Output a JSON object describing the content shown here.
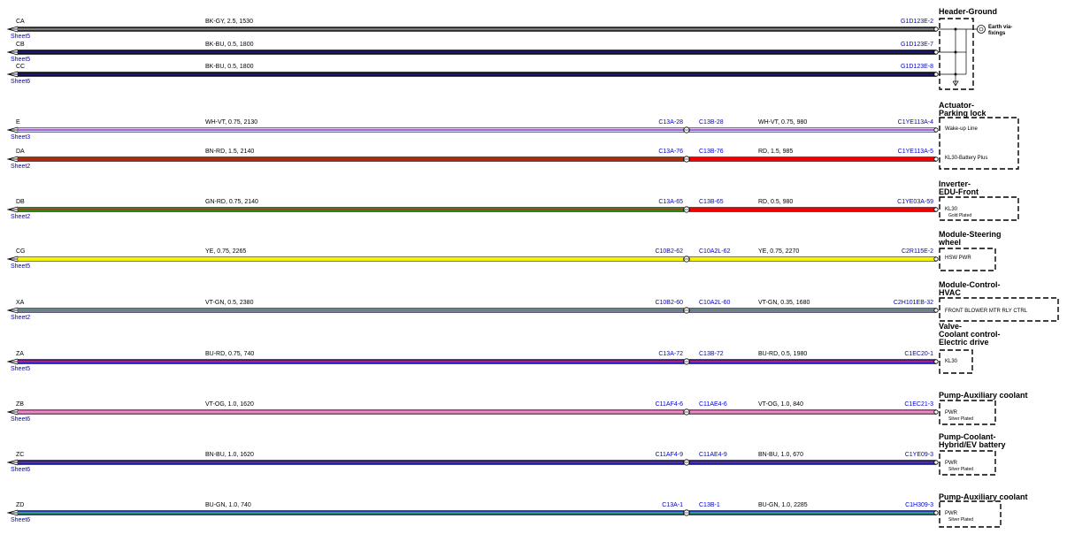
{
  "header_ground": {
    "title": "Header-Ground",
    "earth_label": "Earth via-\nfixings"
  },
  "wires": [
    {
      "id": "CA",
      "sheet": "Sheet5",
      "left_spec": "BK-GY,  2.5,  1530",
      "left_color": "#2a2a2a",
      "left_stripe": "#9a9a9a",
      "terminal": "G1D123E-2",
      "group": "ground"
    },
    {
      "id": "CB",
      "sheet": "Sheet5",
      "left_spec": "BK-BU,  0.5,  1800",
      "left_color": "#111111",
      "left_stripe": "#1a1aa0",
      "terminal": "G1D123E-7",
      "group": "ground"
    },
    {
      "id": "CC",
      "sheet": "Sheet6",
      "left_spec": "BK-BU,  0.5,  1800",
      "left_color": "#111111",
      "left_stripe": "#1a1aa0",
      "terminal": "G1D123E-8",
      "group": "ground"
    },
    {
      "id": "E",
      "sheet": "Sheet3",
      "left_spec": "WH-VT,  0.75,  2130",
      "left_color": "#d0d0ff",
      "left_stripe": "#a040c0",
      "conn_left": "C13A-28",
      "conn_right": "C13B-28",
      "right_spec": "WH-VT,  0.75,  980",
      "right_color": "#d0d0ff",
      "right_stripe": "#a040c0",
      "terminal": "C1YE113A-4"
    },
    {
      "id": "DA",
      "sheet": "Sheet2",
      "left_spec": "BN-RD,  1.5,  2140",
      "left_color": "#8b3a0e",
      "left_stripe": "#cc1a1a",
      "conn_left": "C13A-76",
      "conn_right": "C13B-76",
      "right_spec": "RD,  1.5,  985",
      "right_color": "#ee0000",
      "right_stripe": "#ee0000",
      "terminal": "C1YE113A-5"
    },
    {
      "id": "DB",
      "sheet": "Sheet2",
      "left_spec": "GN-RD,  0.75,  2140",
      "left_color": "#2a8a1a",
      "left_stripe": "#b03a0e",
      "conn_left": "C13A-65",
      "conn_right": "C13B-65",
      "right_spec": "RD,  0.5,  980",
      "right_color": "#ee0000",
      "right_stripe": "#ee0000",
      "terminal": "C1YE03A-59"
    },
    {
      "id": "CG",
      "sheet": "Sheet5",
      "left_spec": "YE,  0.75,  2265",
      "left_color": "#f4f400",
      "left_stripe": "#f4f400",
      "conn_left": "C10B2-62",
      "conn_right": "C10A2L-62",
      "right_spec": "YE,  0.75,  2270",
      "right_color": "#f4f400",
      "right_stripe": "#f4f400",
      "terminal": "C2R115E-2"
    },
    {
      "id": "XA",
      "sheet": "Sheet2",
      "left_spec": "VT-GN,  0.5,  2380",
      "left_color": "#7a7a9a",
      "left_stripe": "#5a8a7a",
      "conn_left": "C10B2-60",
      "conn_right": "C10A2L-60",
      "right_spec": "VT-GN,  0.35,  1680",
      "right_color": "#7a7a9a",
      "right_stripe": "#5a8a7a",
      "terminal": "C2H101EB-32"
    },
    {
      "id": "ZA",
      "sheet": "Sheet5",
      "left_spec": "BU-RD,  0.75,  740",
      "left_color": "#2020c0",
      "left_stripe": "#e0206a",
      "conn_left": "C13A-72",
      "conn_right": "C13B-72",
      "right_spec": "BU-RD,  0.5,  1980",
      "right_color": "#2020c0",
      "right_stripe": "#e0206a",
      "terminal": "C1EC20-1"
    },
    {
      "id": "ZB",
      "sheet": "Sheet6",
      "left_spec": "VT-OG,  1.0,  1620",
      "left_color": "#c05aa0",
      "left_stripe": "#f0a0c0",
      "conn_left": "C11AF4-6",
      "conn_right": "C11AE4-6",
      "right_spec": "VT-OG,  1.0,  840",
      "right_color": "#c05aa0",
      "right_stripe": "#f0a0c0",
      "terminal": "C1EC21-3"
    },
    {
      "id": "ZC",
      "sheet": "Sheet6",
      "left_spec": "BN-BU,  1.0,  1620",
      "left_color": "#1a1aa0",
      "left_stripe": "#6a3a7a",
      "conn_left": "C11AF4-9",
      "conn_right": "C11AE4-9",
      "right_spec": "BN-BU,  1.0,  670",
      "right_color": "#1a1aa0",
      "right_stripe": "#6a3a7a",
      "terminal": "C1YE09-3"
    },
    {
      "id": "ZD",
      "sheet": "Sheet6",
      "left_spec": "BU-GN,  1.0,  740",
      "left_color": "#1a3ab0",
      "left_stripe": "#3ac060",
      "conn_left": "C13A-1",
      "conn_right": "C13B-1",
      "right_spec": "BU-GN,  1.0,  2285",
      "right_color": "#1a3ab0",
      "right_stripe": "#3ac060",
      "terminal": "C1H309-3"
    }
  ],
  "components": [
    {
      "title_lines": [
        "Actuator-",
        "Parking lock"
      ],
      "pins": [
        {
          "label": "Wake-up Line",
          "sub": ""
        },
        {
          "label": "KL30-Battery Plus",
          "sub": ""
        }
      ]
    },
    {
      "title_lines": [
        "Inverter-",
        "EDU-Front"
      ],
      "pins": [
        {
          "label": "KL30",
          "sub": "Gold Plated"
        }
      ]
    },
    {
      "title_lines": [
        "Module-Steering",
        "wheel"
      ],
      "pins": [
        {
          "label": "HSW PWR",
          "sub": ""
        }
      ]
    },
    {
      "title_lines": [
        "Module-Control-",
        "HVAC"
      ],
      "pins": [
        {
          "label": "FRONT BLOWER MTR RLY CTRL",
          "sub": ""
        }
      ]
    },
    {
      "title_lines": [
        "Valve-",
        "Coolant control-",
        "Electric drive"
      ],
      "pins": [
        {
          "label": "KL30",
          "sub": ""
        }
      ]
    },
    {
      "title_lines": [
        "Pump-Auxiliary coolant"
      ],
      "pins": [
        {
          "label": "PWR",
          "sub": "Silver Plated"
        }
      ]
    },
    {
      "title_lines": [
        "Pump-Coolant-",
        "Hybrid/EV battery"
      ],
      "pins": [
        {
          "label": "PWR",
          "sub": "Silver Plated"
        }
      ]
    },
    {
      "title_lines": [
        "Pump-Auxiliary coolant"
      ],
      "pins": [
        {
          "label": "PWR",
          "sub": "Silver Plated"
        }
      ]
    }
  ]
}
